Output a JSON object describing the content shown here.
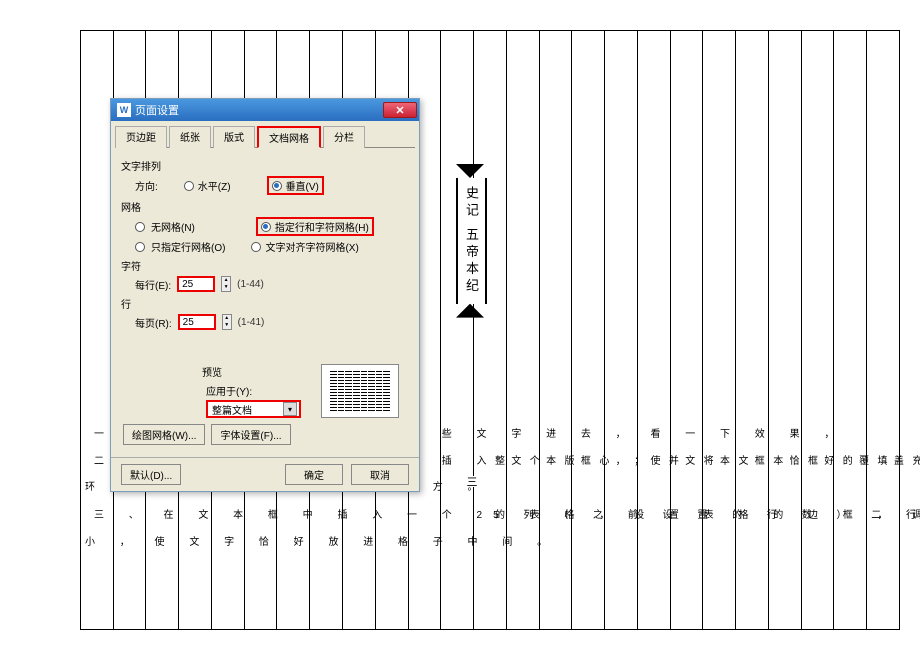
{
  "document": {
    "title_text": "史记 五帝本纪",
    "page_number": "三",
    "lines": {
      "l1": "一 、 先 随 便 打 出 复 制 一 些 文 字 进 去 ， 看 一 下 效 果 ，",
      "l2a": "二 、 选 择 页 眉 和 页 脚 ， 插 入 文 本 框 ， 使 文 本 框 恰 好 覆 盖",
      "l2b": "整 个 版 心 ； 并 将 文 本 框 的 填 充 和 线 框 颜 色 设 置 为 无 。 文 字",
      "l3": "环 绕 设 置 为 衬 于 文 字 下 方 。",
      "l4a": "三 、 在 文 本 框 中 插 入 一 个 25 列 （ 之 前 设 置 的 行 数 ） 二 行",
      "l4b": "的 表 格 ， 设 置 表 格 的 边 框 ， 调 整 文 本 框 的 位 置 和 表 格 的 大",
      "l5": "小 ， 使 文 字 恰 好 放 进 格 子 中 间 。"
    }
  },
  "dialog": {
    "title": "页面设置",
    "tabs": {
      "t0": "页边距",
      "t1": "纸张",
      "t2": "版式",
      "t3": "文档网格",
      "t4": "分栏"
    },
    "sec_direction": "文字排列",
    "direction_label": "方向:",
    "opt_horizontal": "水平(Z)",
    "opt_vertical": "垂直(V)",
    "sec_grid": "网格",
    "opt_nogrid": "无网格(N)",
    "opt_linechar": "指定行和字符网格(H)",
    "opt_lineonly": "只指定行网格(O)",
    "opt_textalign": "文字对齐字符网格(X)",
    "sec_char": "字符",
    "perline_label": "每行(E):",
    "perline_value": "25",
    "perline_range": "(1-44)",
    "sec_line": "行",
    "perpage_label": "每页(R):",
    "perpage_value": "25",
    "perpage_range": "(1-41)",
    "sec_preview": "预览",
    "apply_label": "应用于(Y):",
    "apply_value": "整篇文档",
    "btn_drawgrid": "绘图网格(W)...",
    "btn_font": "字体设置(F)...",
    "btn_default": "默认(D)...",
    "btn_ok": "确定",
    "btn_cancel": "取消"
  }
}
